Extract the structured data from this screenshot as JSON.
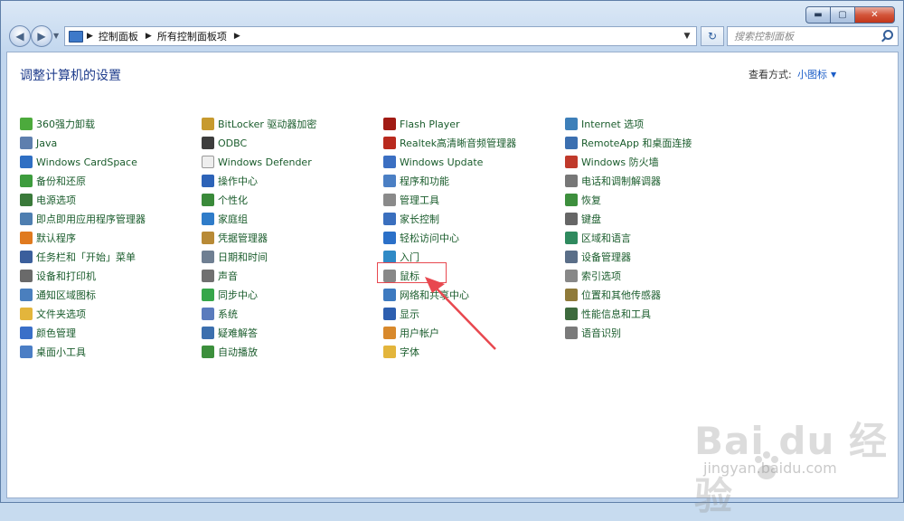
{
  "window": {
    "caption_buttons": {
      "minimize": "▬",
      "maximize": "▢",
      "close": "✕"
    }
  },
  "nav": {
    "back": "◀",
    "forward": "▶",
    "breadcrumb": [
      "控制面板",
      "所有控制面板项"
    ],
    "search_placeholder": "搜索控制面板"
  },
  "header": {
    "title": "调整计算机的设置",
    "view_by_label": "查看方式:",
    "view_by_value": "小图标"
  },
  "items": {
    "col1": [
      "360强力卸载",
      "Java",
      "Windows CardSpace",
      "备份和还原",
      "电源选项",
      "即点即用应用程序管理器",
      "默认程序",
      "任务栏和「开始」菜单",
      "设备和打印机",
      "通知区域图标",
      "文件夹选项",
      "颜色管理",
      "桌面小工具"
    ],
    "col2": [
      "BitLocker 驱动器加密",
      "ODBC",
      "Windows Defender",
      "操作中心",
      "个性化",
      "家庭组",
      "凭据管理器",
      "日期和时间",
      "声音",
      "同步中心",
      "系统",
      "疑难解答",
      "自动播放"
    ],
    "col3": [
      "Flash Player",
      "Realtek高清晰音频管理器",
      "Windows Update",
      "程序和功能",
      "管理工具",
      "家长控制",
      "轻松访问中心",
      "入门",
      "鼠标",
      "网络和共享中心",
      "显示",
      "用户帐户",
      "字体"
    ],
    "col4": [
      "Internet 选项",
      "RemoteApp 和桌面连接",
      "Windows 防火墙",
      "电话和调制解调器",
      "恢复",
      "键盘",
      "区域和语言",
      "设备管理器",
      "索引选项",
      "位置和其他传感器",
      "性能信息和工具",
      "语音识别"
    ]
  },
  "icon_colors": {
    "col1": [
      "#4caa3c",
      "#5e7fae",
      "#2f6fc3",
      "#3d9c3d",
      "#3a7a3a",
      "#4e7eb0",
      "#e07a1f",
      "#3b5f9c",
      "#6a6a6a",
      "#4a7fbe",
      "#e3b53c",
      "#3a6fc8",
      "#4b7ec5"
    ],
    "col2": [
      "#c79a2e",
      "#3d3d3d",
      "#eeeeee",
      "#2d63b8",
      "#3a8a3a",
      "#2f7cc9",
      "#b88a36",
      "#6f7f92",
      "#707070",
      "#36a64a",
      "#5a7bbd",
      "#3c6fae",
      "#3c8f3c"
    ],
    "col3": [
      "#a11b14",
      "#b92a1e",
      "#3b6fc2",
      "#4b7fc4",
      "#8a8a8a",
      "#3a6fbe",
      "#2b70c8",
      "#2f8ac6",
      "#888888",
      "#3e7ac0",
      "#2d5fb0",
      "#d8892c",
      "#e3b53c"
    ],
    "col4": [
      "#3d7fb9",
      "#3b6fb0",
      "#c0392b",
      "#777777",
      "#3d8f3d",
      "#666666",
      "#2f8a5e",
      "#5a6e88",
      "#888888",
      "#8f7a3a",
      "#3d6a3d",
      "#7a7a7a"
    ]
  },
  "watermark": {
    "logo": "Bai du 经验",
    "url": "jingyan.baidu.com"
  }
}
